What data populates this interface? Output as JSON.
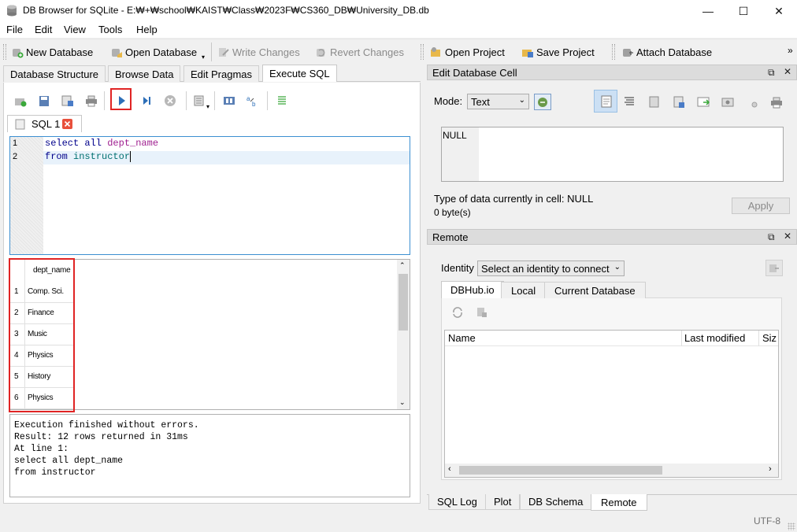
{
  "window": {
    "title": "DB Browser for SQLite - E:₩+₩school₩KAIST₩Class₩2023F₩CS360_DB₩University_DB.db",
    "minimize": "—",
    "maximize": "☐",
    "close": "✕"
  },
  "menu": [
    "File",
    "Edit",
    "View",
    "Tools",
    "Help"
  ],
  "toolbar": {
    "new_database": "New Database",
    "open_database": "Open Database",
    "write_changes": "Write Changes",
    "revert_changes": "Revert Changes",
    "open_project": "Open Project",
    "save_project": "Save Project",
    "attach_database": "Attach Database",
    "overflow": "»"
  },
  "main_tabs": [
    "Database Structure",
    "Browse Data",
    "Edit Pragmas",
    "Execute SQL"
  ],
  "active_main_tab": "Execute SQL",
  "sql_tab": {
    "label": "SQL 1"
  },
  "editor": {
    "lines": [
      {
        "num": "1",
        "kw": "select all ",
        "id": "dept_name"
      },
      {
        "num": "2",
        "kw": "from ",
        "id": "instructor"
      }
    ]
  },
  "results": {
    "column": "dept_name",
    "rows": [
      {
        "n": "1",
        "value": "Comp. Sci."
      },
      {
        "n": "2",
        "value": "Finance"
      },
      {
        "n": "3",
        "value": "Music"
      },
      {
        "n": "4",
        "value": "Physics"
      },
      {
        "n": "5",
        "value": "History"
      },
      {
        "n": "6",
        "value": "Physics"
      }
    ]
  },
  "log": [
    "Execution finished without errors.",
    "Result: 12 rows returned in 31ms",
    "At line 1:",
    "select all dept_name",
    "from instructor"
  ],
  "edit_cell": {
    "title": "Edit Database Cell",
    "mode_label": "Mode:",
    "mode_value": "Text",
    "cell_value": "NULL",
    "type_info": "Type of data currently in cell: NULL",
    "size_info": "0 byte(s)",
    "apply": "Apply"
  },
  "remote": {
    "title": "Remote",
    "identity_label": "Identity",
    "identity_placeholder": "Select an identity to connect",
    "tabs": [
      "DBHub.io",
      "Local",
      "Current Database"
    ],
    "columns": [
      "Name",
      "Last modified",
      "Siz"
    ]
  },
  "bottom_tabs": [
    "SQL Log",
    "Plot",
    "DB Schema",
    "Remote"
  ],
  "active_bottom_tab": "Remote",
  "status": {
    "encoding": "UTF-8"
  },
  "colors": {
    "accent": "#3c8fd1",
    "highlight": "#e02424"
  }
}
